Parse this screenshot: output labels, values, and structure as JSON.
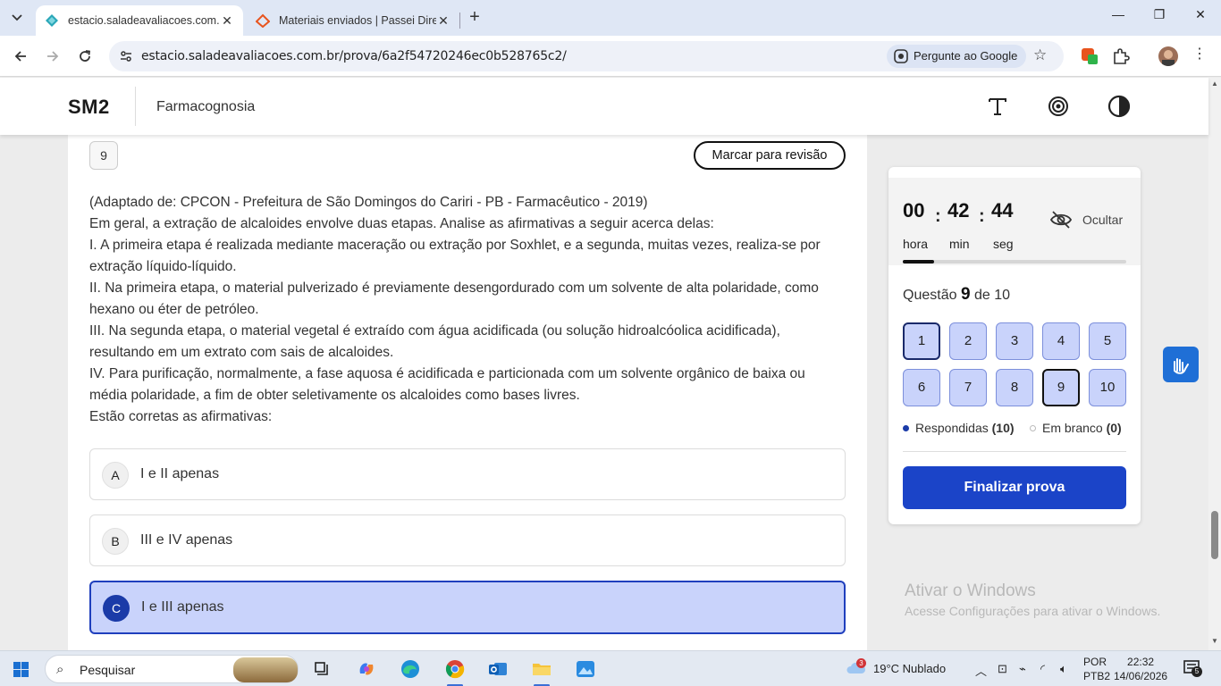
{
  "browser": {
    "tabs": [
      {
        "title": "estacio.saladeavaliacoes.com.br",
        "active": true
      },
      {
        "title": "Materiais enviados | Passei Direto",
        "active": false
      }
    ],
    "url": "estacio.saladeavaliacoes.com.br/prova/6a2f54720246ec0b528765c2/",
    "ask_google_label": "Pergunte ao Google"
  },
  "site": {
    "logo": "SM2",
    "course": "Farmacognosia"
  },
  "question": {
    "number": "9",
    "review_button": "Marcar para revisão",
    "lines": [
      "(Adaptado de: CPCON - Prefeitura de São Domingos do Cariri - PB - Farmacêutico - 2019)",
      "Em geral, a extração de alcaloides envolve duas etapas. Analise as afirmativas a seguir acerca delas:",
      "I. A primeira etapa é realizada mediante maceração ou extração por Soxhlet, e a segunda, muitas vezes, realiza-se por extração líquido-líquido.",
      "II. Na primeira etapa, o material pulverizado é previamente desengordurado com um solvente de alta polaridade, como hexano ou éter de petróleo.",
      "III. Na segunda etapa, o material vegetal é extraído com água acidificada (ou solução hidroalcóolica acidificada), resultando em um extrato com sais de alcaloides.",
      "IV. Para purificação, normalmente, a fase aquosa é acidificada e particionada com um solvente orgânico de baixa ou média polaridade, a fim de obter seletivamente os alcaloides como bases livres.",
      "Estão corretas as afirmativas:"
    ],
    "options": [
      {
        "letter": "A",
        "text": "I e II apenas",
        "selected": false
      },
      {
        "letter": "B",
        "text": "III e IV apenas",
        "selected": false
      },
      {
        "letter": "C",
        "text": "I e III apenas",
        "selected": true
      }
    ]
  },
  "timer": {
    "hours": "00",
    "hours_label": "hora",
    "minutes": "42",
    "minutes_label": "min",
    "seconds": "44",
    "seconds_label": "seg",
    "hide_label": "Ocultar",
    "progress_fraction": 0.14
  },
  "navigator": {
    "prefix": "Questão",
    "current": "9",
    "suffix": "de 10",
    "buttons": [
      "1",
      "2",
      "3",
      "4",
      "5",
      "6",
      "7",
      "8",
      "9",
      "10"
    ],
    "answered_label": "Respondidas",
    "answered_count": "(10)",
    "blank_label": "Em branco",
    "blank_count": "(0)",
    "finish_label": "Finalizar prova"
  },
  "watermark": {
    "title": "Ativar o Windows",
    "subtitle": "Acesse Configurações para ativar o Windows."
  },
  "taskbar": {
    "search_placeholder": "Pesquisar",
    "weather_badge": "3",
    "weather": "19°C  Nublado",
    "lang_line1": "POR",
    "lang_line2": "PTB2",
    "time": "22:32",
    "date": "14/06/2026",
    "notification_count": "5"
  },
  "colors": {
    "accent": "#1b44c8",
    "answered_bg": "#c9d3fb",
    "answered_dot": "#1b3ba8"
  }
}
